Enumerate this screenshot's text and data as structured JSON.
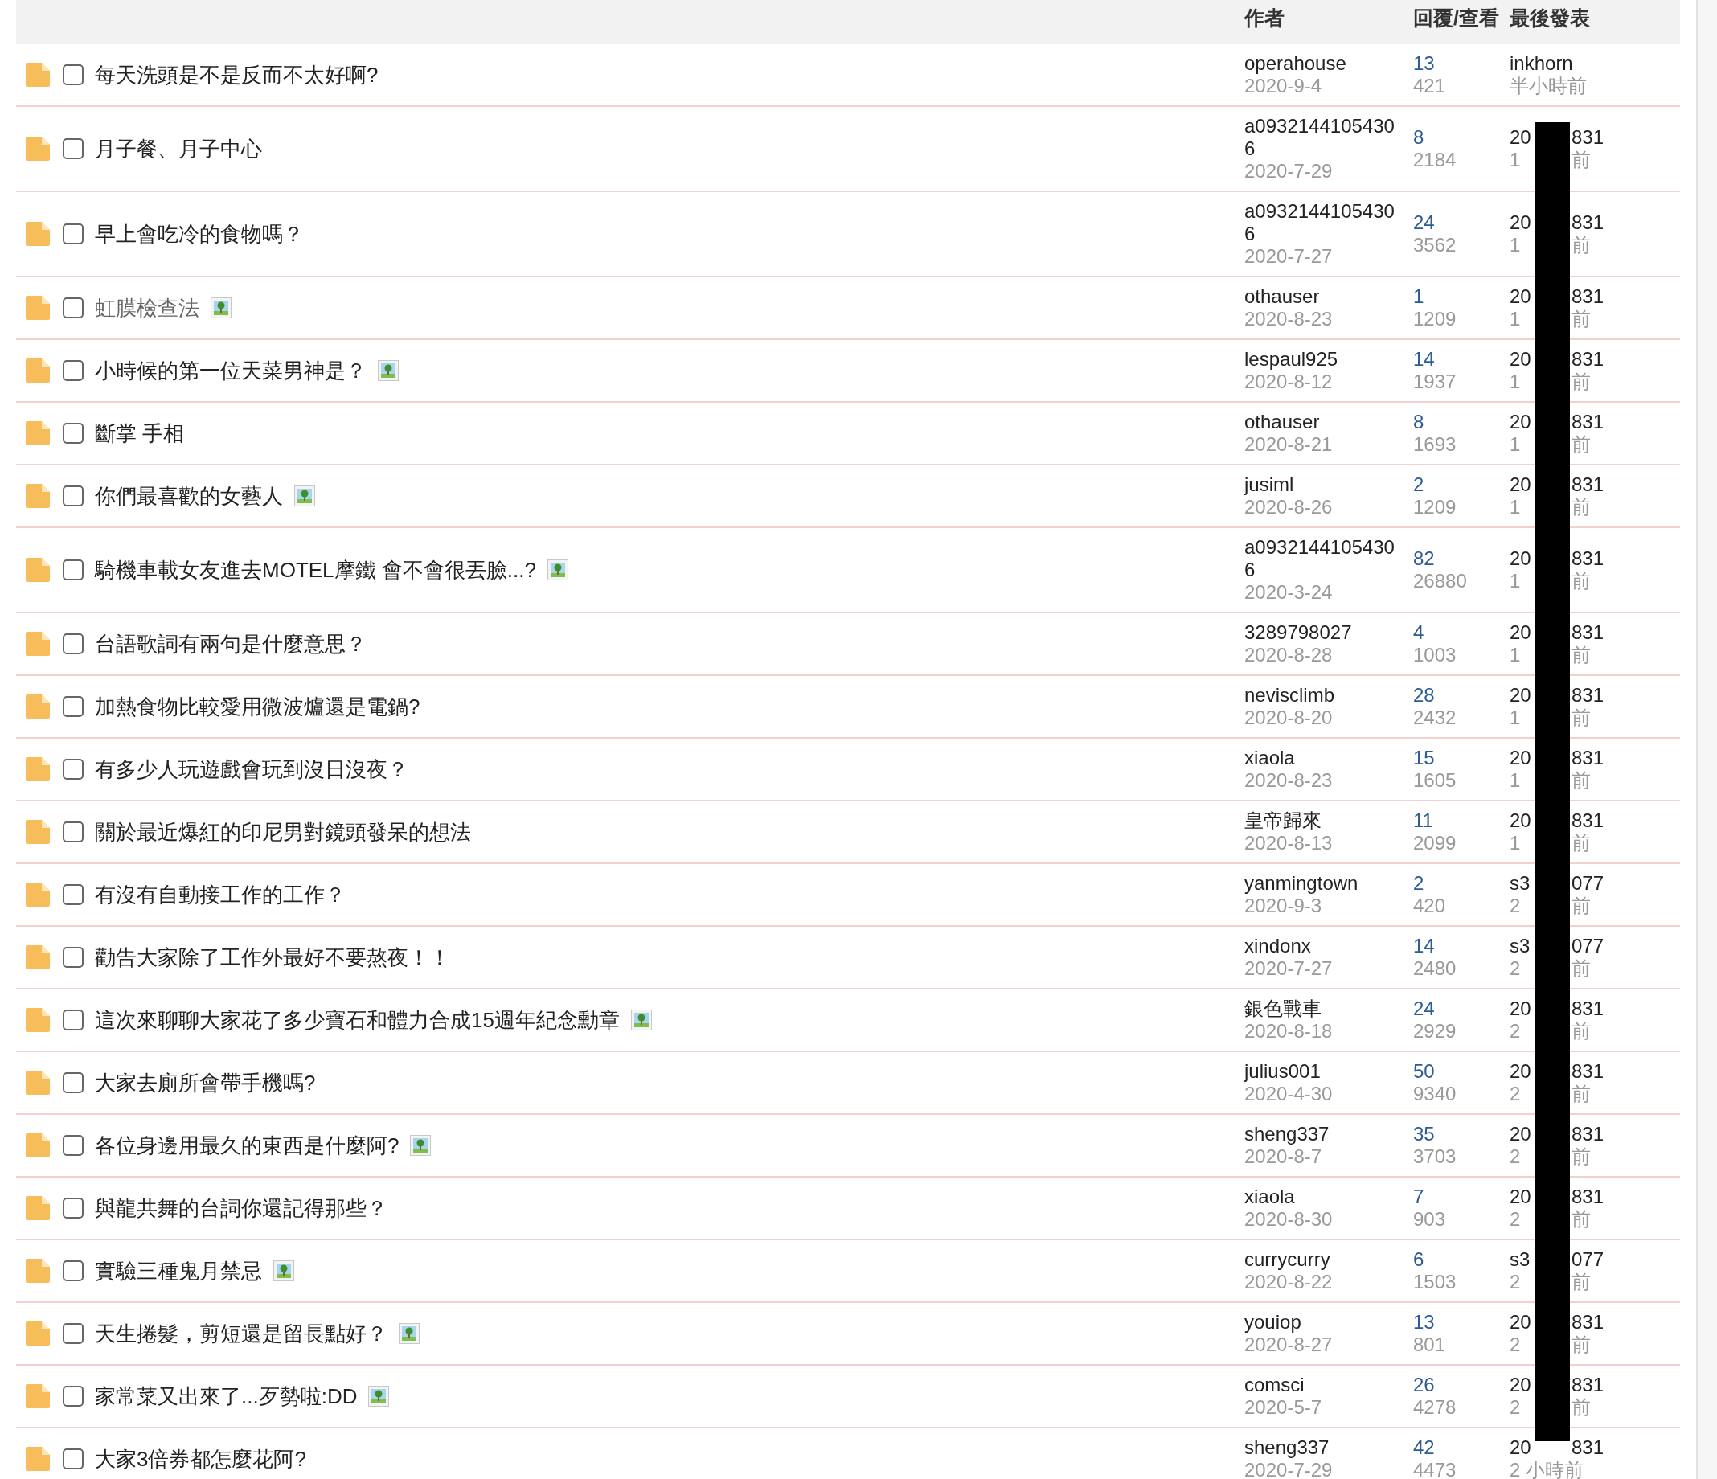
{
  "header": {
    "author": "作者",
    "stats": "回覆/查看",
    "last_post": "最後發表"
  },
  "redaction_bar": true,
  "topics": [
    {
      "title": "每天洗頭是不是反而不太好啊?",
      "visited": false,
      "checked": false,
      "has_image": false,
      "author": "operahouse",
      "date": "2020-9-4",
      "replies": "13",
      "views": "421",
      "last_poster": [
        "inkhorn"
      ],
      "last_time": [
        "半小時前"
      ]
    },
    {
      "title": "月子餐、月子中心",
      "visited": false,
      "checked": false,
      "has_image": false,
      "author": "a09321441054306",
      "date": "2020-7-29",
      "replies": "8",
      "views": "2184",
      "last_poster": [
        "20",
        "831"
      ],
      "last_time": [
        "1",
        "前"
      ]
    },
    {
      "title": "早上會吃冷的食物嗎？",
      "visited": false,
      "checked": false,
      "has_image": false,
      "author": "a09321441054306",
      "date": "2020-7-27",
      "replies": "24",
      "views": "3562",
      "last_poster": [
        "20",
        "831"
      ],
      "last_time": [
        "1",
        "前"
      ]
    },
    {
      "title": "虹膜檢查法",
      "visited": true,
      "checked": false,
      "has_image": true,
      "author": "othauser",
      "date": "2020-8-23",
      "replies": "1",
      "views": "1209",
      "last_poster": [
        "20",
        "831"
      ],
      "last_time": [
        "1",
        "前"
      ]
    },
    {
      "title": "小時候的第一位天菜男神是？",
      "visited": false,
      "checked": false,
      "has_image": true,
      "author": "lespaul925",
      "date": "2020-8-12",
      "replies": "14",
      "views": "1937",
      "last_poster": [
        "20",
        "831"
      ],
      "last_time": [
        "1",
        "前"
      ]
    },
    {
      "title": "斷掌 手相",
      "visited": false,
      "checked": false,
      "has_image": false,
      "author": "othauser",
      "date": "2020-8-21",
      "replies": "8",
      "views": "1693",
      "last_poster": [
        "20",
        "831"
      ],
      "last_time": [
        "1",
        "前"
      ]
    },
    {
      "title": "你們最喜歡的女藝人",
      "visited": false,
      "checked": false,
      "has_image": true,
      "author": "jusiml",
      "date": "2020-8-26",
      "replies": "2",
      "views": "1209",
      "last_poster": [
        "20",
        "831"
      ],
      "last_time": [
        "1",
        "前"
      ]
    },
    {
      "title": "騎機車載女友進去MOTEL摩鐵 會不會很丟臉...?",
      "visited": false,
      "checked": false,
      "has_image": true,
      "author": "a09321441054306",
      "date": "2020-3-24",
      "replies": "82",
      "views": "26880",
      "last_poster": [
        "20",
        "831"
      ],
      "last_time": [
        "1",
        "前"
      ]
    },
    {
      "title": "台語歌詞有兩句是什麼意思？",
      "visited": false,
      "checked": false,
      "has_image": false,
      "author": "3289798027",
      "date": "2020-8-28",
      "replies": "4",
      "views": "1003",
      "last_poster": [
        "20",
        "831"
      ],
      "last_time": [
        "1",
        "前"
      ]
    },
    {
      "title": "加熱食物比較愛用微波爐還是電鍋?",
      "visited": false,
      "checked": false,
      "has_image": false,
      "author": "nevisclimb",
      "date": "2020-8-20",
      "replies": "28",
      "views": "2432",
      "last_poster": [
        "20",
        "831"
      ],
      "last_time": [
        "1",
        "前"
      ]
    },
    {
      "title": "有多少人玩遊戲會玩到沒日沒夜？",
      "visited": false,
      "checked": false,
      "has_image": false,
      "author": "xiaola",
      "date": "2020-8-23",
      "replies": "15",
      "views": "1605",
      "last_poster": [
        "20",
        "831"
      ],
      "last_time": [
        "1",
        "前"
      ]
    },
    {
      "title": "關於最近爆紅的印尼男對鏡頭發呆的想法",
      "visited": false,
      "checked": false,
      "has_image": false,
      "author": "皇帝歸來",
      "date": "2020-8-13",
      "replies": "11",
      "views": "2099",
      "last_poster": [
        "20",
        "831"
      ],
      "last_time": [
        "1",
        "前"
      ]
    },
    {
      "title": "有沒有自動接工作的工作？",
      "visited": false,
      "checked": false,
      "has_image": false,
      "author": "yanmingtown",
      "date": "2020-9-3",
      "replies": "2",
      "views": "420",
      "last_poster": [
        "s3",
        "077"
      ],
      "last_time": [
        "2",
        "前"
      ]
    },
    {
      "title": "勸告大家除了工作外最好不要熬夜！！",
      "visited": false,
      "checked": false,
      "has_image": false,
      "author": "xindonx",
      "date": "2020-7-27",
      "replies": "14",
      "views": "2480",
      "last_poster": [
        "s3",
        "077"
      ],
      "last_time": [
        "2",
        "前"
      ]
    },
    {
      "title": "這次來聊聊大家花了多少寶石和體力合成15週年紀念勳章",
      "visited": false,
      "checked": false,
      "has_image": true,
      "author": "銀色戰車",
      "date": "2020-8-18",
      "replies": "24",
      "views": "2929",
      "last_poster": [
        "20",
        "831"
      ],
      "last_time": [
        "2",
        "前"
      ]
    },
    {
      "title": "大家去廁所會帶手機嗎?",
      "visited": false,
      "checked": false,
      "has_image": false,
      "author": "julius001",
      "date": "2020-4-30",
      "replies": "50",
      "views": "9340",
      "last_poster": [
        "20",
        "831"
      ],
      "last_time": [
        "2",
        "前"
      ]
    },
    {
      "title": "各位身邊用最久的東西是什麼阿?",
      "visited": false,
      "checked": false,
      "has_image": true,
      "author": "sheng337",
      "date": "2020-8-7",
      "replies": "35",
      "views": "3703",
      "last_poster": [
        "20",
        "831"
      ],
      "last_time": [
        "2",
        "前"
      ]
    },
    {
      "title": "與龍共舞的台詞你還記得那些？",
      "visited": false,
      "checked": false,
      "has_image": false,
      "author": "xiaola",
      "date": "2020-8-30",
      "replies": "7",
      "views": "903",
      "last_poster": [
        "20",
        "831"
      ],
      "last_time": [
        "2",
        "前"
      ]
    },
    {
      "title": "實驗三種鬼月禁忌",
      "visited": false,
      "checked": false,
      "has_image": true,
      "author": "currycurry",
      "date": "2020-8-22",
      "replies": "6",
      "views": "1503",
      "last_poster": [
        "s3",
        "077"
      ],
      "last_time": [
        "2",
        "前"
      ]
    },
    {
      "title": "天生捲髮，剪短還是留長點好？",
      "visited": false,
      "checked": false,
      "has_image": true,
      "author": "youiop",
      "date": "2020-8-27",
      "replies": "13",
      "views": "801",
      "last_poster": [
        "20",
        "831"
      ],
      "last_time": [
        "2",
        "前"
      ]
    },
    {
      "title": "家常菜又出來了...歹勢啦:DD",
      "visited": false,
      "checked": false,
      "has_image": true,
      "author": "comsci",
      "date": "2020-5-7",
      "replies": "26",
      "views": "4278",
      "last_poster": [
        "20",
        "831"
      ],
      "last_time": [
        "2",
        "前"
      ]
    },
    {
      "title": "大家3倍券都怎麼花阿?",
      "visited": false,
      "checked": false,
      "has_image": false,
      "author": "sheng337",
      "date": "2020-7-29",
      "replies": "42",
      "views": "4473",
      "last_poster": [
        "20",
        "831"
      ],
      "last_time": [
        "2 小時前"
      ]
    }
  ]
}
